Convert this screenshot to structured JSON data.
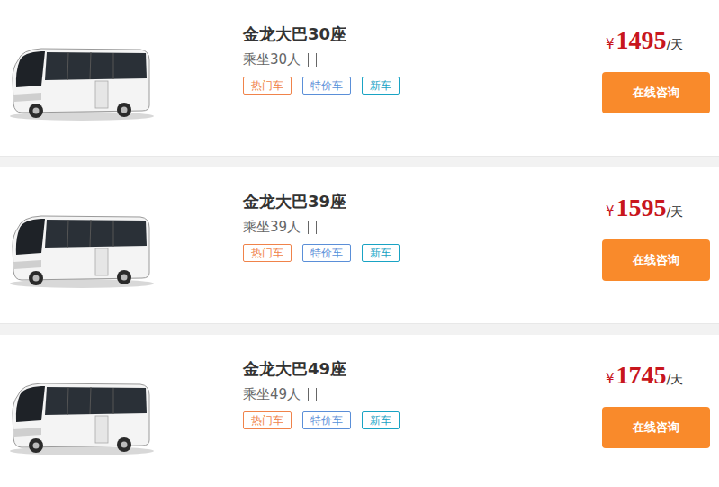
{
  "listings": [
    {
      "title": "金龙大巴30座",
      "capacity": "乘坐30人",
      "tags": [
        {
          "label": "热门车",
          "color": "#f0834a"
        },
        {
          "label": "特价车",
          "color": "#5a8fd8"
        },
        {
          "label": "新车",
          "color": "#19a3c4"
        }
      ],
      "price": {
        "currency": "¥",
        "amount": "1495",
        "unit": "/天"
      },
      "button": "在线咨询"
    },
    {
      "title": "金龙大巴39座",
      "capacity": "乘坐39人",
      "tags": [
        {
          "label": "热门车",
          "color": "#f0834a"
        },
        {
          "label": "特价车",
          "color": "#5a8fd8"
        },
        {
          "label": "新车",
          "color": "#19a3c4"
        }
      ],
      "price": {
        "currency": "¥",
        "amount": "1595",
        "unit": "/天"
      },
      "button": "在线咨询"
    },
    {
      "title": "金龙大巴49座",
      "capacity": "乘坐49人",
      "tags": [
        {
          "label": "热门车",
          "color": "#f0834a"
        },
        {
          "label": "特价车",
          "color": "#5a8fd8"
        },
        {
          "label": "新车",
          "color": "#19a3c4"
        }
      ],
      "price": {
        "currency": "¥",
        "amount": "1745",
        "unit": "/天"
      },
      "button": "在线咨询"
    }
  ]
}
